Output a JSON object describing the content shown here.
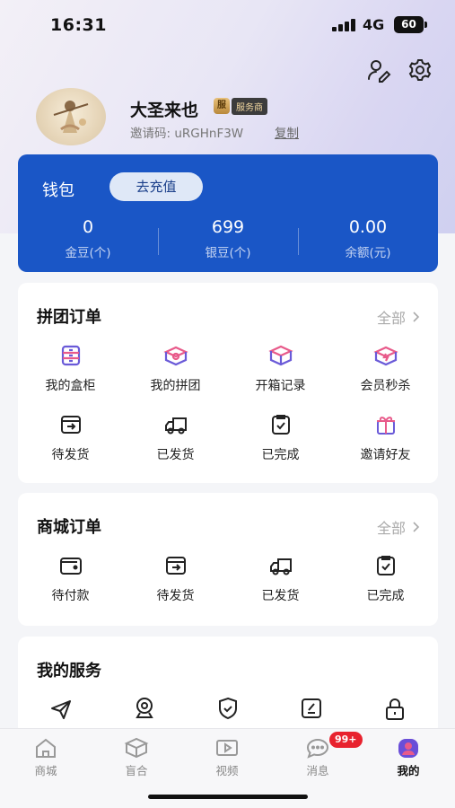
{
  "status_bar": {
    "time": "16:31",
    "network": "4G",
    "battery": "60"
  },
  "header": {
    "settings_icon": "gear-icon",
    "profile_edit_icon": "user-edit-icon"
  },
  "profile": {
    "name": "大圣来也",
    "badge_icon_text": "服",
    "badge_label": "服务商",
    "invite_text": "邀请码: uRGHnF3W",
    "copy_label": "复制"
  },
  "wallet": {
    "title": "钱包",
    "recharge_label": "去充值",
    "stats": [
      {
        "value": "0",
        "label": "金豆(个)"
      },
      {
        "value": "699",
        "label": "银豆(个)"
      },
      {
        "value": "0.00",
        "label": "余额(元)"
      }
    ]
  },
  "group_orders": {
    "title": "拼团订单",
    "more_label": "全部",
    "items": [
      {
        "label": "我的盒柜",
        "icon": "cabinet-icon"
      },
      {
        "label": "我的拼团",
        "icon": "group-box-icon"
      },
      {
        "label": "开箱记录",
        "icon": "open-box-icon"
      },
      {
        "label": "会员秒杀",
        "icon": "flash-sale-icon"
      },
      {
        "label": "待发货",
        "icon": "pending-ship-icon"
      },
      {
        "label": "已发货",
        "icon": "truck-icon"
      },
      {
        "label": "已完成",
        "icon": "completed-icon"
      },
      {
        "label": "邀请好友",
        "icon": "gift-icon"
      }
    ]
  },
  "mall_orders": {
    "title": "商城订单",
    "more_label": "全部",
    "items": [
      {
        "label": "待付款",
        "icon": "wallet-icon"
      },
      {
        "label": "待发货",
        "icon": "pending-ship-icon"
      },
      {
        "label": "已发货",
        "icon": "truck-icon"
      },
      {
        "label": "已完成",
        "icon": "completed-icon"
      }
    ]
  },
  "services": {
    "title": "我的服务",
    "items": [
      {
        "icon": "send-icon"
      },
      {
        "icon": "location-icon"
      },
      {
        "icon": "shield-check-icon"
      },
      {
        "icon": "edit-square-icon"
      },
      {
        "icon": "lock-icon"
      }
    ]
  },
  "tabbar": {
    "items": [
      {
        "label": "商城",
        "icon": "home-icon"
      },
      {
        "label": "盲合",
        "icon": "box-icon"
      },
      {
        "label": "视频",
        "icon": "video-icon"
      },
      {
        "label": "消息",
        "icon": "chat-icon"
      },
      {
        "label": "我的",
        "icon": "profile-icon"
      }
    ],
    "message_badge": "99+",
    "active_color": "#6a4ed8"
  },
  "colors": {
    "wallet_bg": "#1a56c6",
    "badge_red": "#e8222e"
  }
}
